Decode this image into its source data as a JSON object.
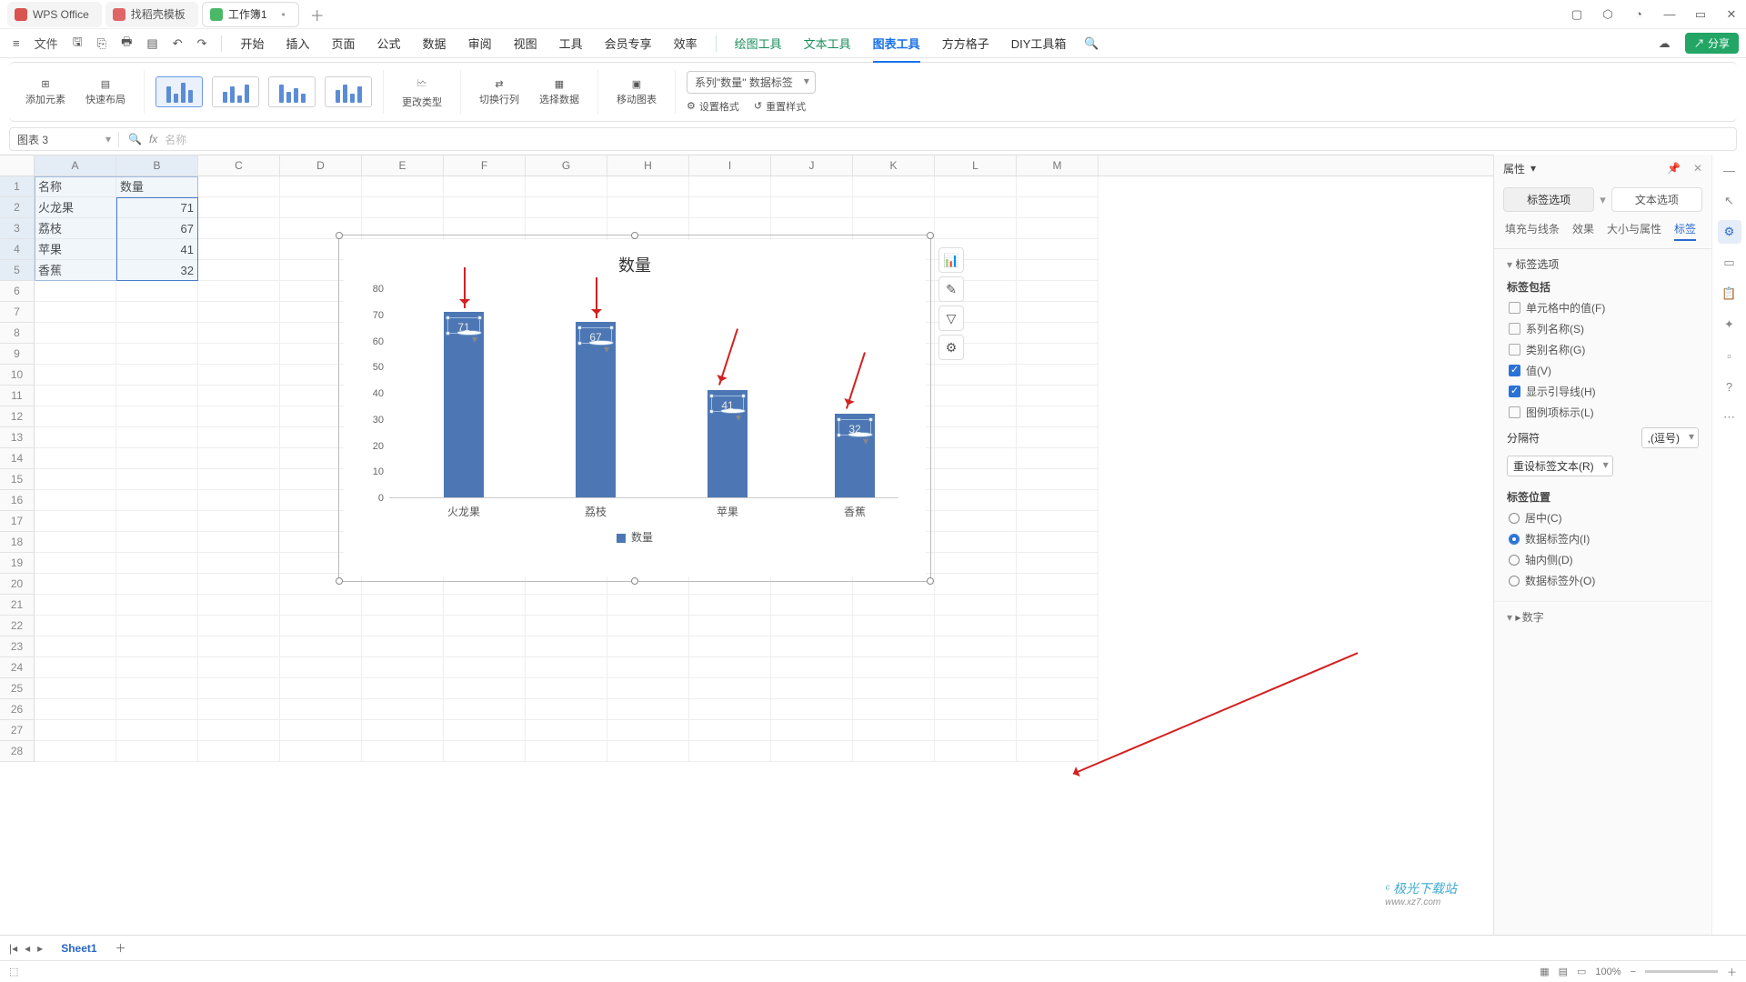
{
  "titlebar": {
    "tabs": [
      {
        "label": "WPS Office",
        "icon": "wps"
      },
      {
        "label": "找稻壳模板",
        "icon": "find"
      },
      {
        "label": "工作簿1",
        "icon": "sheet",
        "active": true
      }
    ]
  },
  "menubar": {
    "file": "文件",
    "tabs": [
      "开始",
      "插入",
      "页面",
      "公式",
      "数据",
      "审阅",
      "视图",
      "工具",
      "会员专享",
      "效率"
    ],
    "tool_tabs": [
      "绘图工具",
      "文本工具",
      "图表工具",
      "方方格子",
      "DIY工具箱"
    ],
    "active_tool": "图表工具",
    "share": "分享"
  },
  "ribbon": {
    "add_element": "添加元素",
    "quick_layout": "快速布局",
    "change_type": "更改类型",
    "switch_rowcol": "切换行列",
    "select_data": "选择数据",
    "move_chart": "移动图表",
    "series_selector": "系列\"数量\" 数据标签",
    "set_format": "设置格式",
    "reset_style": "重置样式"
  },
  "formula": {
    "name_box": "图表 3",
    "fx": "fx",
    "value": "名称"
  },
  "grid": {
    "columns": [
      "A",
      "B",
      "C",
      "D",
      "E",
      "F",
      "G",
      "H",
      "I",
      "J",
      "K",
      "L",
      "M"
    ],
    "rows": 28,
    "data": [
      [
        "名称",
        "数量"
      ],
      [
        "火龙果",
        "71"
      ],
      [
        "荔枝",
        "67"
      ],
      [
        "苹果",
        "41"
      ],
      [
        "香蕉",
        "32"
      ]
    ]
  },
  "chart_data": {
    "type": "bar",
    "title": "数量",
    "categories": [
      "火龙果",
      "荔枝",
      "苹果",
      "香蕉"
    ],
    "values": [
      71,
      67,
      41,
      32
    ],
    "series_name": "数量",
    "ylim": [
      0,
      80
    ],
    "yticks": [
      0,
      10,
      20,
      30,
      40,
      50,
      60,
      70,
      80
    ],
    "xlabel": "",
    "ylabel": ""
  },
  "chart_float": [
    "📊",
    "✎",
    "⚙",
    "▼"
  ],
  "panel": {
    "title": "属性",
    "tab_label": "标签选项",
    "tab_text": "文本选项",
    "subs": [
      "填充与线条",
      "效果",
      "大小与属性",
      "标签"
    ],
    "sec_label_options": "标签选项",
    "includes_title": "标签包括",
    "chk_cell_value": "单元格中的值(F)",
    "chk_series_name": "系列名称(S)",
    "chk_category_name": "类别名称(G)",
    "chk_value": "值(V)",
    "chk_leader_lines": "显示引导线(H)",
    "chk_legend_key": "图例项标示(L)",
    "separator_label": "分隔符",
    "separator_value": ",(逗号)",
    "reset_label_text": "重设标签文本(R)",
    "position_title": "标签位置",
    "pos_center": "居中(C)",
    "pos_inside_end": "数据标签内(I)",
    "pos_inside_base": "轴内侧(D)",
    "pos_outside_end": "数据标签外(O)",
    "sec_number": "数字"
  },
  "sheet_tabs": {
    "sheet1": "Sheet1"
  },
  "status": {
    "zoom": "100%"
  },
  "watermark": {
    "name": "极光下载站",
    "url": "www.xz7.com"
  }
}
